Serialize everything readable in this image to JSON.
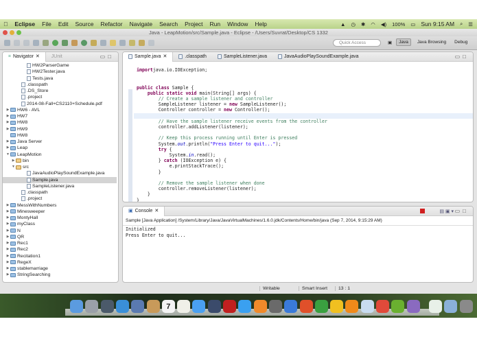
{
  "menubar": {
    "app": "Eclipse",
    "items": [
      "File",
      "Edit",
      "Source",
      "Refactor",
      "Navigate",
      "Search",
      "Project",
      "Run",
      "Window",
      "Help"
    ],
    "battery": "100%",
    "clock": "Sun 9:15 AM"
  },
  "window": {
    "title": "Java - LeapMotion/src/Sample.java - Eclipse - /Users/Suvrat/Desktop/CS 1332"
  },
  "toolbar": {
    "quick_access_placeholder": "Quick Access",
    "perspectives": [
      "Java",
      "Java Browsing",
      "Debug"
    ]
  },
  "navigator": {
    "tabs": [
      "Navigator",
      "JUnit"
    ],
    "rows": [
      {
        "label": "HW2ParserGame",
        "indent": 3,
        "type": "file"
      },
      {
        "label": "HW2Tester.java",
        "indent": 3,
        "type": "java"
      },
      {
        "label": "Tests.java",
        "indent": 3,
        "type": "java"
      },
      {
        "label": ".classpath",
        "indent": 2,
        "type": "file"
      },
      {
        "label": ".DS_Store",
        "indent": 2,
        "type": "file"
      },
      {
        "label": ".project",
        "indent": 2,
        "type": "file"
      },
      {
        "label": "2014-08-Fall+CS2110+Schedule.pdf",
        "indent": 2,
        "type": "file"
      },
      {
        "label": "HW6 - AVL",
        "indent": 0,
        "type": "project",
        "toggle": "collapsed"
      },
      {
        "label": "HW7",
        "indent": 0,
        "type": "project",
        "toggle": "collapsed"
      },
      {
        "label": "HW8",
        "indent": 0,
        "type": "project",
        "toggle": "collapsed"
      },
      {
        "label": "HW9",
        "indent": 0,
        "type": "project",
        "toggle": "collapsed"
      },
      {
        "label": "HW8",
        "indent": 0,
        "type": "closed"
      },
      {
        "label": "Java Server",
        "indent": 0,
        "type": "project",
        "toggle": "collapsed"
      },
      {
        "label": "Leap",
        "indent": 0,
        "type": "project",
        "toggle": "collapsed"
      },
      {
        "label": "LeapMotion",
        "indent": 0,
        "type": "project",
        "toggle": "expanded"
      },
      {
        "label": "bin",
        "indent": 1,
        "type": "folder",
        "toggle": "collapsed"
      },
      {
        "label": "src",
        "indent": 1,
        "type": "folder",
        "toggle": "expanded"
      },
      {
        "label": "JavaAudioPlaySoundExample.java",
        "indent": 3,
        "type": "java"
      },
      {
        "label": "Sample.java",
        "indent": 3,
        "type": "java",
        "selected": true
      },
      {
        "label": "SampleListener.java",
        "indent": 3,
        "type": "java"
      },
      {
        "label": ".classpath",
        "indent": 2,
        "type": "file"
      },
      {
        "label": ".project",
        "indent": 2,
        "type": "file"
      },
      {
        "label": "MessWithNumbers",
        "indent": 0,
        "type": "project",
        "toggle": "collapsed"
      },
      {
        "label": "Minesweeper",
        "indent": 0,
        "type": "project",
        "toggle": "collapsed"
      },
      {
        "label": "MontyHall",
        "indent": 0,
        "type": "project",
        "toggle": "collapsed"
      },
      {
        "label": "myClass",
        "indent": 0,
        "type": "project",
        "toggle": "collapsed"
      },
      {
        "label": "N",
        "indent": 0,
        "type": "project",
        "toggle": "collapsed"
      },
      {
        "label": "QR",
        "indent": 0,
        "type": "project",
        "toggle": "collapsed"
      },
      {
        "label": "Rec1",
        "indent": 0,
        "type": "project",
        "toggle": "collapsed"
      },
      {
        "label": "Rec2",
        "indent": 0,
        "type": "project",
        "toggle": "collapsed"
      },
      {
        "label": "Recitation1",
        "indent": 0,
        "type": "project",
        "toggle": "collapsed"
      },
      {
        "label": "RegeX",
        "indent": 0,
        "type": "project",
        "toggle": "collapsed"
      },
      {
        "label": "stablemarriage",
        "indent": 0,
        "type": "project",
        "toggle": "collapsed"
      },
      {
        "label": "StringSearching",
        "indent": 0,
        "type": "project",
        "toggle": "collapsed"
      }
    ]
  },
  "editor": {
    "tabs": [
      "Sample.java",
      ".classpath",
      "SampleListener.java",
      "JavaAudioPlaySoundExample.java"
    ],
    "active_tab": 0,
    "lines": [
      [
        [
          "kw",
          "import"
        ],
        [
          "",
          "java.io.IOException;"
        ]
      ],
      [],
      [],
      [
        [
          "kw",
          "public class"
        ],
        [
          "",
          " Sample {"
        ]
      ],
      [
        [
          "",
          "    "
        ],
        [
          "kw",
          "public static void"
        ],
        [
          "",
          " main(String[] args) {"
        ]
      ],
      [
        [
          "",
          "        "
        ],
        [
          "cm",
          "// Create a sample listener and controller"
        ]
      ],
      [
        [
          "",
          "        SampleListener listener = "
        ],
        [
          "kw",
          "new"
        ],
        [
          "",
          " SampleListener();"
        ]
      ],
      [
        [
          "",
          "        Controller controller = "
        ],
        [
          "kw",
          "new"
        ],
        [
          "",
          " Controller();"
        ]
      ],
      [],
      [
        [
          "",
          "        "
        ],
        [
          "cm",
          "// Have the sample listener receive events from the controller"
        ]
      ],
      [
        [
          "",
          "        controller.addListener(listener);"
        ]
      ],
      [],
      [
        [
          "",
          "        "
        ],
        [
          "cm",
          "// Keep this process running until Enter is pressed"
        ]
      ],
      [
        [
          "",
          "        System."
        ],
        [
          "fld",
          "out"
        ],
        [
          "",
          ".println("
        ],
        [
          "str",
          "\"Press Enter to quit...\""
        ],
        [
          "",
          ");"
        ]
      ],
      [
        [
          "",
          "        "
        ],
        [
          "kw",
          "try"
        ],
        [
          "",
          " {"
        ]
      ],
      [
        [
          "",
          "            System."
        ],
        [
          "fld",
          "in"
        ],
        [
          "",
          ".read();"
        ]
      ],
      [
        [
          "",
          "        } "
        ],
        [
          "kw",
          "catch"
        ],
        [
          "",
          " (IOException e) {"
        ]
      ],
      [
        [
          "",
          "            e.printStackTrace();"
        ]
      ],
      [
        [
          "",
          "        }"
        ]
      ],
      [],
      [
        [
          "",
          "        "
        ],
        [
          "cm",
          "// Remove the sample listener when done"
        ]
      ],
      [
        [
          "",
          "        controller.removeListener(listener);"
        ]
      ],
      [
        [
          "",
          "    }"
        ]
      ],
      [
        [
          "",
          "}"
        ]
      ]
    ],
    "cursor_line": 13
  },
  "console": {
    "title": "Console",
    "meta": "Sample [Java Application] /System/Library/Java/JavaVirtualMachines/1.6.0.jdk/Contents/Home/bin/java (Sep 7, 2014, 9:15:29 AM)",
    "output": "Initialized\nPress Enter to quit..."
  },
  "status": {
    "mode": "Writable",
    "insert": "Smart Insert",
    "position": "13 : 1"
  },
  "dock": {
    "calendar_day": "7",
    "colors": [
      "#5b9be0",
      "#9aa0a8",
      "#4b5a6a",
      "#3a8fd8",
      "#5a7ab0",
      "#c89a5a",
      "#f4f4f4",
      "#f0f0e8",
      "#4aa0f0",
      "#3b4b6b",
      "#c02020",
      "#3aa0f0",
      "#f08a2a",
      "#6a6a6a",
      "#3a7ad8",
      "#e0502a",
      "#3aa040",
      "#f0c020",
      "#f08a1a",
      "#c8dcf0",
      "#e04a3a",
      "#6ab030",
      "#8a6ac0",
      "#e8f0e8",
      "#8ab0d8",
      "#8a8a8a"
    ]
  }
}
